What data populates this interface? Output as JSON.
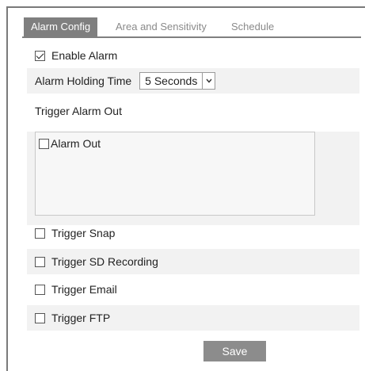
{
  "tabs": [
    {
      "label": "Alarm Config",
      "active": true
    },
    {
      "label": "Area and Sensitivity",
      "active": false
    },
    {
      "label": "Schedule",
      "active": false
    }
  ],
  "enable_alarm": {
    "label": "Enable Alarm",
    "checked": true
  },
  "holding_time": {
    "label": "Alarm Holding Time",
    "value": "5 Seconds"
  },
  "trigger_alarm_out": {
    "label": "Trigger Alarm Out"
  },
  "alarm_out": {
    "label": "Alarm Out",
    "checked": false
  },
  "triggers": [
    {
      "label": "Trigger Snap",
      "checked": false
    },
    {
      "label": "Trigger SD Recording",
      "checked": false
    },
    {
      "label": "Trigger Email",
      "checked": false
    },
    {
      "label": "Trigger FTP",
      "checked": false
    }
  ],
  "save_label": "Save",
  "colors": {
    "tab_active_bg": "#7f7f7f",
    "row_shade": "#f2f2f2",
    "button_bg": "#8c8c8c"
  }
}
